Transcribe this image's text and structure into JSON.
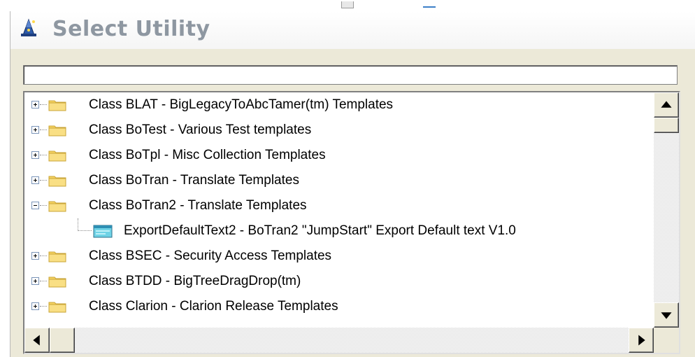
{
  "window": {
    "title": "Select Utility",
    "title_icon": "wizard-hat-icon"
  },
  "search": {
    "value": "",
    "placeholder": ""
  },
  "tree": {
    "items": [
      {
        "label": "Class BLAT - BigLegacyToAbcTamer(tm) Templates",
        "expanded": false,
        "icon": "folder-icon"
      },
      {
        "label": "Class BoTest - Various Test templates",
        "expanded": false,
        "icon": "folder-icon"
      },
      {
        "label": "Class BoTpl - Misc Collection Templates",
        "expanded": false,
        "icon": "folder-icon"
      },
      {
        "label": "Class BoTran -  Translate Templates",
        "expanded": false,
        "icon": "folder-icon"
      },
      {
        "label": "Class BoTran2 -  Translate Templates",
        "expanded": true,
        "icon": "folder-icon",
        "children": [
          {
            "label": "ExportDefaultText2 - BoTran2 \"JumpStart\" Export Default text V1.0",
            "icon": "utility-template-icon"
          }
        ]
      },
      {
        "label": "Class BSEC - Security Access Templates",
        "expanded": false,
        "icon": "folder-icon"
      },
      {
        "label": "Class BTDD - BigTreeDragDrop(tm)",
        "expanded": false,
        "icon": "folder-icon"
      },
      {
        "label": "Class Clarion - Clarion Release Templates",
        "expanded": false,
        "icon": "folder-icon"
      }
    ]
  },
  "colors": {
    "title_text": "#8e97a1",
    "folder": "#f6d361",
    "window_bg": "#ece9d8"
  }
}
